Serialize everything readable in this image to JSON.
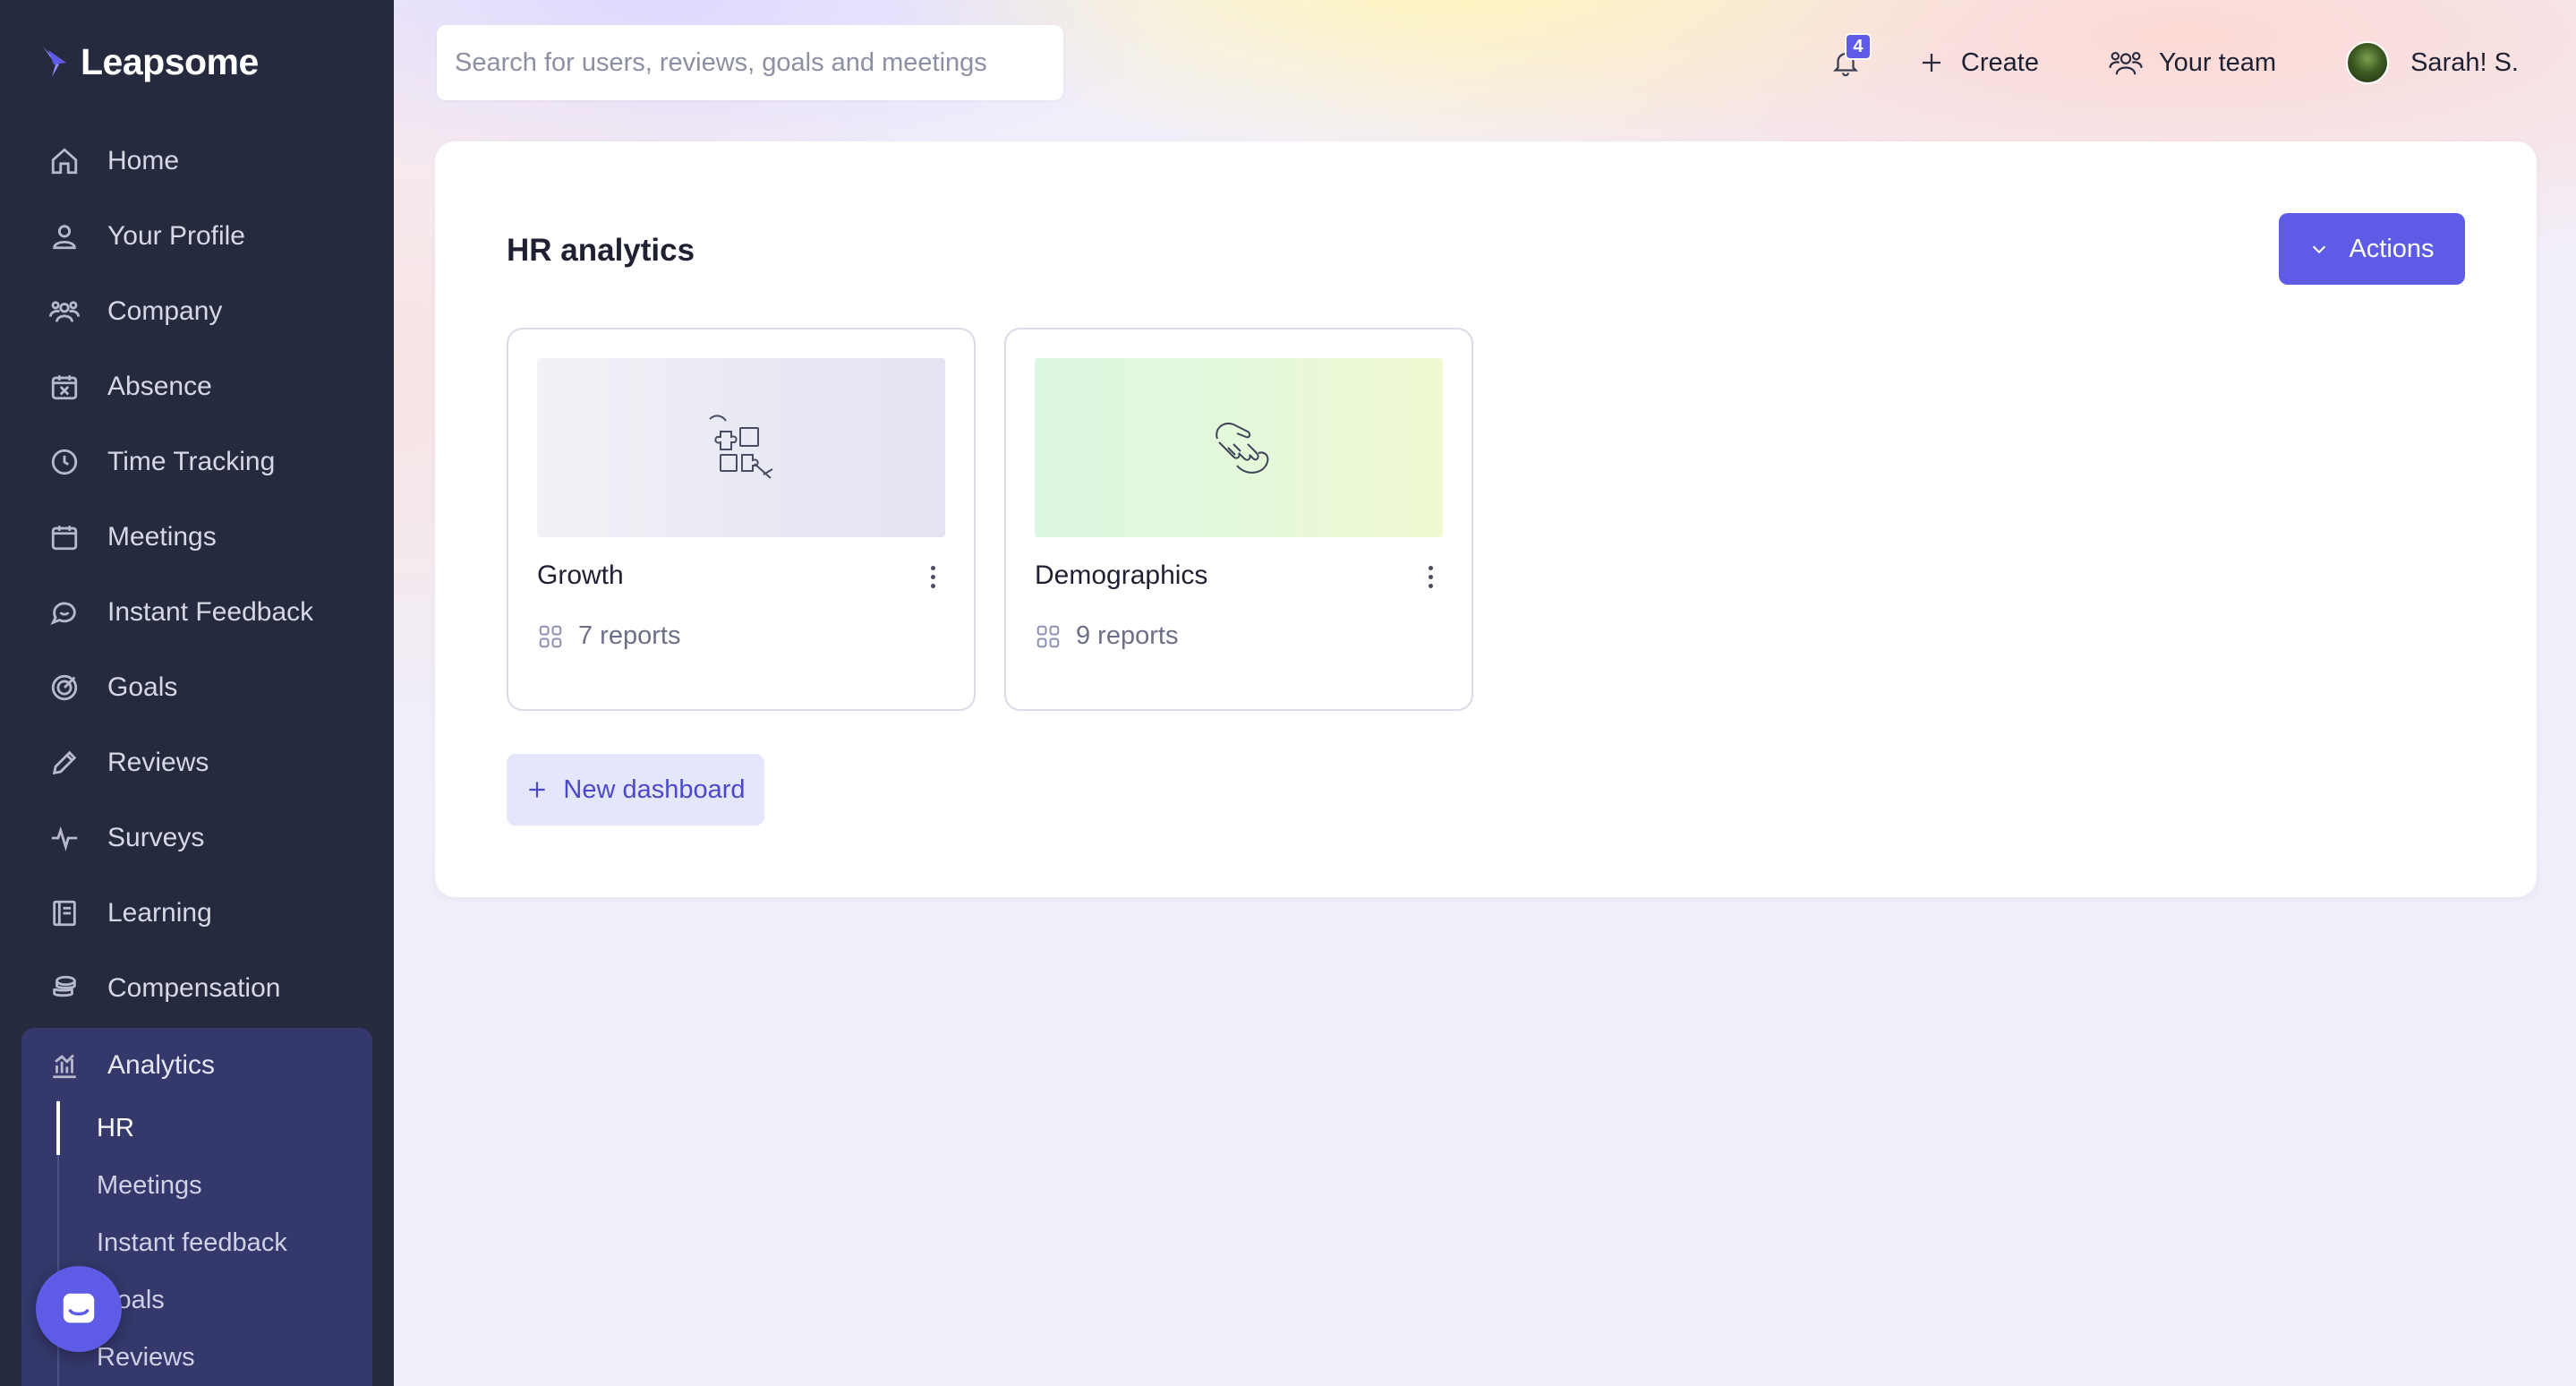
{
  "app": {
    "logo_text": "Leapsome"
  },
  "sidebar": {
    "items": [
      {
        "label": "Home",
        "icon": "home-icon"
      },
      {
        "label": "Your Profile",
        "icon": "user-icon"
      },
      {
        "label": "Company",
        "icon": "people-icon"
      },
      {
        "label": "Absence",
        "icon": "calendar-x-icon"
      },
      {
        "label": "Time Tracking",
        "icon": "clock-icon"
      },
      {
        "label": "Meetings",
        "icon": "calendar-icon"
      },
      {
        "label": "Instant Feedback",
        "icon": "chat-icon"
      },
      {
        "label": "Goals",
        "icon": "target-icon"
      },
      {
        "label": "Reviews",
        "icon": "pencil-icon"
      },
      {
        "label": "Surveys",
        "icon": "pulse-icon"
      },
      {
        "label": "Learning",
        "icon": "book-icon"
      },
      {
        "label": "Compensation",
        "icon": "coins-icon"
      }
    ],
    "analytics": {
      "label": "Analytics",
      "icon": "chart-icon",
      "sub_items": [
        "HR",
        "Meetings",
        "Instant feedback",
        "Goals",
        "Reviews"
      ],
      "active_sub": "HR"
    }
  },
  "header": {
    "search_placeholder": "Search for users, reviews, goals and meetings",
    "notification_count": "4",
    "create_label": "Create",
    "team_label": "Your team",
    "user_name": "Sarah! S."
  },
  "main": {
    "title": "HR analytics",
    "actions_label": "Actions",
    "dashboards": [
      {
        "name": "Growth",
        "reports": "7 reports"
      },
      {
        "name": "Demographics",
        "reports": "9 reports"
      }
    ],
    "new_dashboard_label": "New dashboard"
  },
  "colors": {
    "accent": "#5e5ce6",
    "sidebar_bg": "#262a3f",
    "sidebar_active_group": "#34386a"
  }
}
